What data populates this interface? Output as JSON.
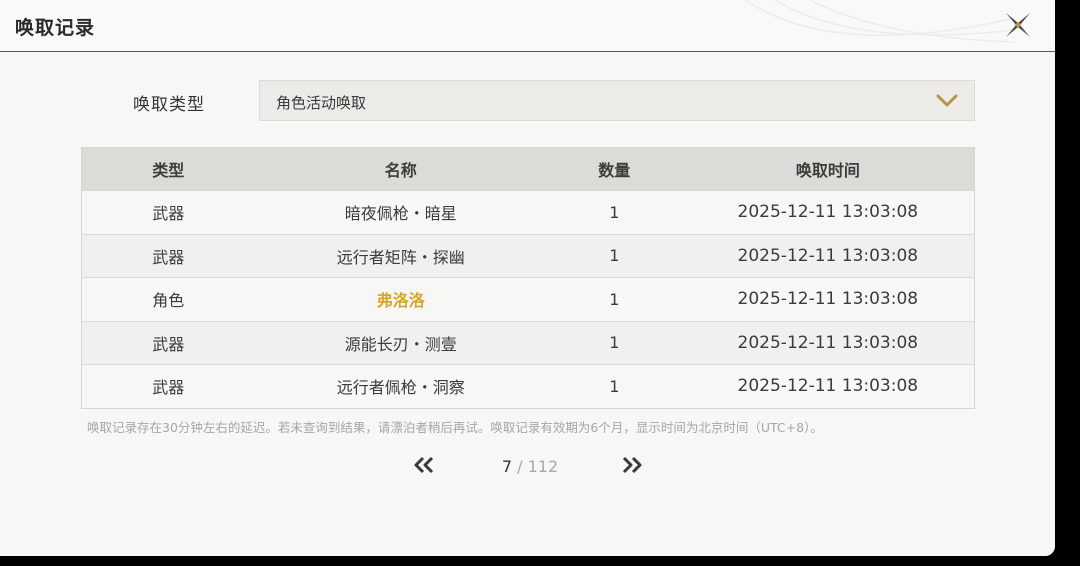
{
  "header": {
    "title": "唤取记录",
    "close_icon": "close-x-icon"
  },
  "filter": {
    "label": "唤取类型",
    "selected": "角色活动唤取",
    "chevron_icon": "chevron-down-icon"
  },
  "table": {
    "columns": [
      "类型",
      "名称",
      "数量",
      "唤取时间"
    ],
    "rows": [
      {
        "type": "武器",
        "name": "暗夜佩枪・暗星",
        "qty": "1",
        "time": "2025-12-11 13:03:08",
        "highlight": false
      },
      {
        "type": "武器",
        "name": "远行者矩阵・探幽",
        "qty": "1",
        "time": "2025-12-11 13:03:08",
        "highlight": false
      },
      {
        "type": "角色",
        "name": "弗洛洛",
        "qty": "1",
        "time": "2025-12-11 13:03:08",
        "highlight": true
      },
      {
        "type": "武器",
        "name": "源能长刃・测壹",
        "qty": "1",
        "time": "2025-12-11 13:03:08",
        "highlight": false
      },
      {
        "type": "武器",
        "name": "远行者佩枪・洞察",
        "qty": "1",
        "time": "2025-12-11 13:03:08",
        "highlight": false
      }
    ]
  },
  "note": "唤取记录存在30分钟左右的延迟。若未查询到结果，请漂泊者稍后再试。唤取记录有效期为6个月，显示时间为北京时间（UTC+8）。",
  "pager": {
    "current": "7",
    "separator": " / ",
    "total": "112",
    "prev_icon": "double-chevron-left-icon",
    "next_icon": "double-chevron-right-icon"
  },
  "colors": {
    "highlight_gold": "#d7a62a",
    "chevron_gold": "#b8963f",
    "panel_bg": "#f7f7f5"
  }
}
